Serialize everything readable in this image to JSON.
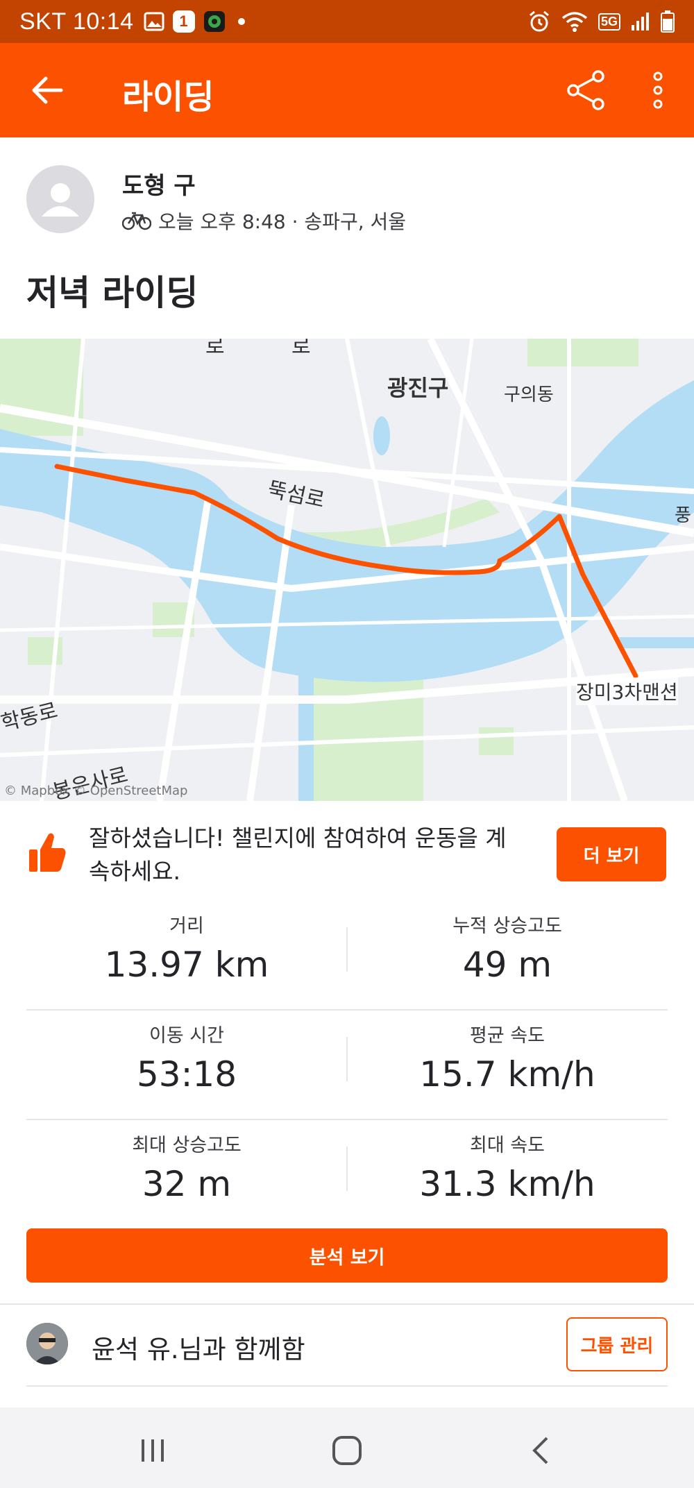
{
  "status_bar": {
    "carrier_time": "SKT 10:14",
    "notification_badge": "1",
    "network": "5G",
    "icons": [
      "gallery-icon",
      "camera-icon",
      "alarm-icon",
      "wifi-icon",
      "signal-icon",
      "battery-icon"
    ]
  },
  "app_bar": {
    "title": "라이딩",
    "icons": [
      "back-arrow-icon",
      "share-icon",
      "more-vert-icon"
    ]
  },
  "activity": {
    "athlete_name": "도형 구",
    "meta": "오늘 오후 8:48 · 송파구, 서울",
    "title": "저녁 라이딩"
  },
  "map": {
    "labels": {
      "gwangjin": "광진구",
      "guui": "구의동",
      "ttukseom": "뚝섬로",
      "jangmi": "장미3차맨션",
      "hakdong": "학동로",
      "bongeun": "봉은사로",
      "pung": "풍",
      "top_left": "로",
      "top_mid": "로"
    },
    "attribution": "© Mapbox © OpenStreetMap",
    "route_color": "#fc5200",
    "water_color": "#b3dcf5"
  },
  "challenge": {
    "text": "잘하셨습니다! 챌린지에 참여하여 운동을 계속하세요.",
    "button": "더 보기"
  },
  "stats": [
    {
      "left_label": "거리",
      "left_value": "13.97 km",
      "right_label": "누적 상승고도",
      "right_value": "49 m"
    },
    {
      "left_label": "이동 시간",
      "left_value": "53:18",
      "right_label": "평균 속도",
      "right_value": "15.7 km/h"
    },
    {
      "left_label": "최대 상승고도",
      "left_value": "32 m",
      "right_label": "최대 속도",
      "right_value": "31.3 km/h"
    }
  ],
  "analysis_button": "분석 보기",
  "group": {
    "text": "윤석 유.님과 함께함",
    "button": "그룹 관리"
  },
  "colors": {
    "brand": "#fc5200",
    "status_bar": "#c24400"
  }
}
